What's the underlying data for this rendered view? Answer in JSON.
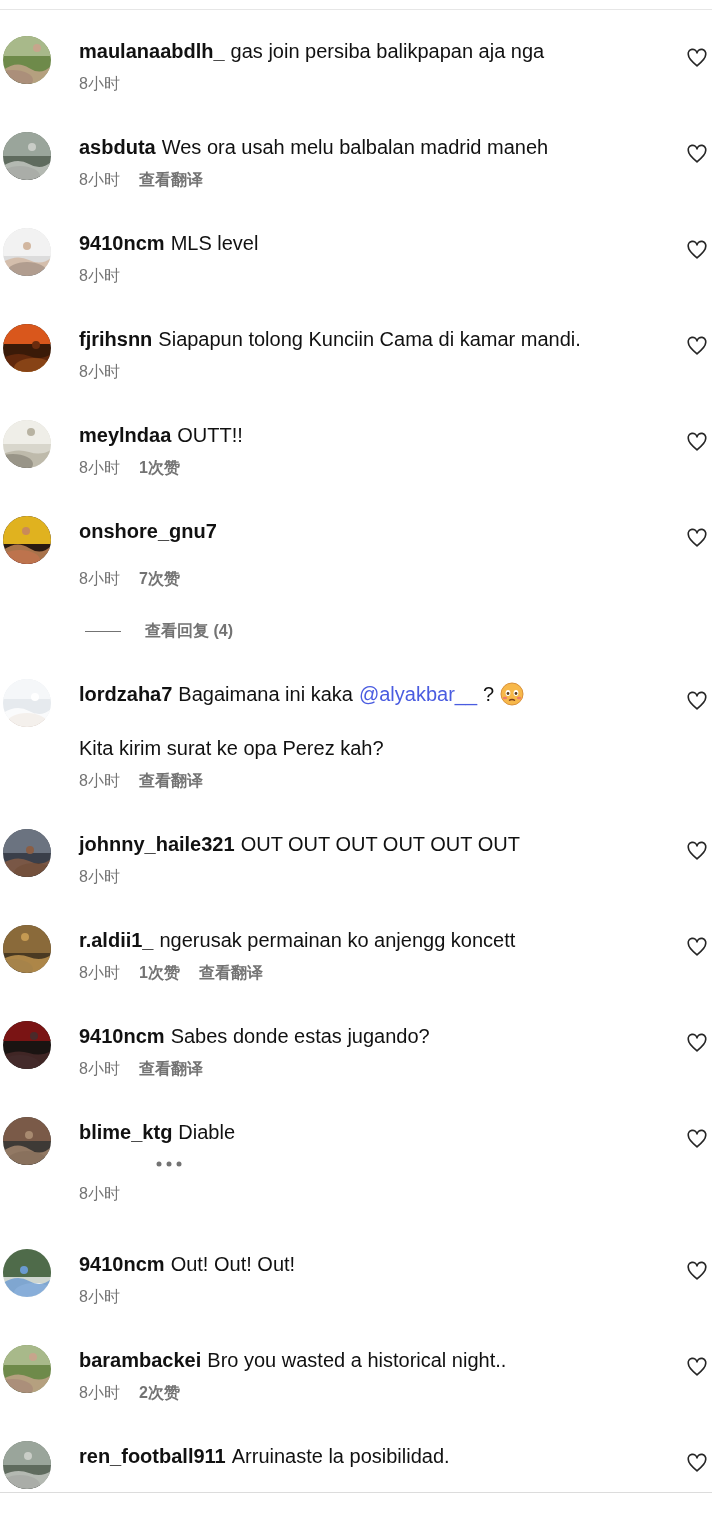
{
  "comments": [
    {
      "username": "maulanaabdlh_",
      "text": "gas join persiba balikpapan aja nga",
      "time": "8小时",
      "liked": false
    },
    {
      "username": "asbduta",
      "text": "Wes ora usah melu balbalan madrid maneh",
      "time": "8小时",
      "translate": "查看翻译",
      "liked": false
    },
    {
      "username": "9410ncm",
      "text": "MLS level",
      "time": "8小时",
      "liked": false
    },
    {
      "username": "fjrihsnn",
      "text": "Siapapun tolong Kunciin Cama di kamar mandi.",
      "time": "8小时",
      "liked": false
    },
    {
      "username": "meylndaa",
      "text": "OUTT!!",
      "time": "8小时",
      "likes": "1次赞",
      "liked": false
    },
    {
      "username": "onshore_gnu7",
      "time": "8小时",
      "likes": "7次赞",
      "replies": "查看回复 (4)",
      "liked": false
    },
    {
      "username": "lordzaha7",
      "text": "Bagaimana ini kaka",
      "mention": "@alyakbar__",
      "text_after": "?",
      "emoji": true,
      "text_2": "Kita kirim surat ke opa Perez kah?",
      "time": "8小时",
      "translate": "查看翻译",
      "liked": false
    },
    {
      "username": "johnny_haile321",
      "text": "OUT OUT OUT OUT OUT OUT",
      "time": "8小时",
      "liked": false
    },
    {
      "username": "r.aldii1_",
      "text": "ngerusak permainan ko anjengg koncett",
      "time": "8小时",
      "likes": "1次赞",
      "translate": "查看翻译",
      "liked": false
    },
    {
      "username": "9410ncm",
      "text": "Sabes donde estas jugando?",
      "time": "8小时",
      "translate": "查看翻译",
      "liked": false
    },
    {
      "username": "blime_ktg",
      "text": "Diable",
      "loading": true,
      "time": "8小时",
      "liked": false
    },
    {
      "username": "9410ncm",
      "text": "Out! Out! Out!",
      "time": "8小时",
      "liked": false
    },
    {
      "username": "barambackei",
      "text": "Bro you wasted a historical night..",
      "time": "8小时",
      "likes": "2次赞",
      "liked": false
    },
    {
      "username": "ren_football911",
      "text": "Arruinaste la posibilidad.",
      "liked": false
    }
  ]
}
